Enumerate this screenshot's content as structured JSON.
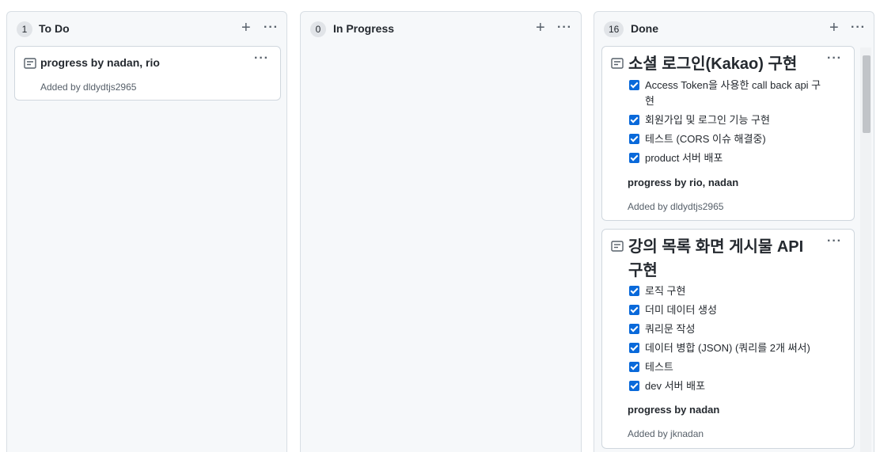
{
  "columns": [
    {
      "count": "1",
      "title": "To Do",
      "add_icon": "plus-icon",
      "menu_icon": "kebab-icon",
      "cards": [
        {
          "note": "progress by nadan, rio",
          "added_by": "Added by dldydtjs2965"
        }
      ]
    },
    {
      "count": "0",
      "title": "In Progress",
      "add_icon": "plus-icon",
      "menu_icon": "kebab-icon",
      "cards": []
    },
    {
      "count": "16",
      "title": "Done",
      "add_icon": "plus-icon",
      "menu_icon": "kebab-icon",
      "cards": [
        {
          "title": "소셜 로그인(Kakao) 구현",
          "items": [
            "Access Token을 사용한 call back api 구현",
            "회원가입 및 로그인 기능 구현",
            "테스트 (CORS 이슈 해결중)",
            "product 서버 배포"
          ],
          "note": "progress by rio, nadan",
          "added_by": "Added by dldydtjs2965"
        },
        {
          "title_line1": "강의 목록 화면 게시물 API",
          "title_line2": "구현",
          "items": [
            "로직 구현",
            "더미 데이터 생성",
            "쿼리문 작성",
            "데이터 병합 (JSON) (쿼리를 2개 써서)",
            "테스트",
            "dev 서버 배포"
          ],
          "note": "progress by nadan",
          "added_by": "Added by jknadan"
        }
      ]
    }
  ],
  "glyphs": {
    "plus": "+",
    "dots": "···"
  },
  "colors": {
    "checkbox": "#0969da",
    "column_bg": "#f6f8fa",
    "card_border": "#d0d7de"
  }
}
